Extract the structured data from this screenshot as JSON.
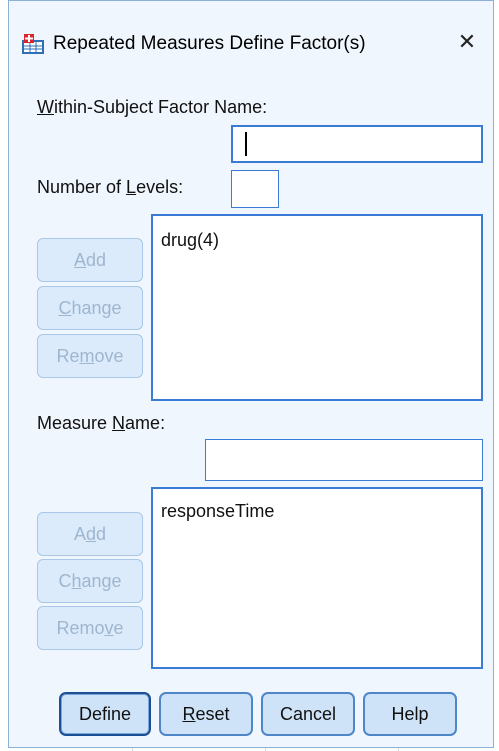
{
  "dialog": {
    "title": "Repeated Measures Define Factor(s)",
    "close_glyph": "✕"
  },
  "within_factor": {
    "label_prefix": "W",
    "label_rest": "ithin-Subject Factor Name:",
    "value": ""
  },
  "levels": {
    "label_pre": "Number of ",
    "label_u": "L",
    "label_post": "evels:",
    "value": ""
  },
  "factor_buttons": {
    "add": {
      "pre": "",
      "u": "A",
      "post": "dd"
    },
    "change": {
      "pre": "",
      "u": "C",
      "post": "hange"
    },
    "remove": {
      "pre": "Re",
      "u": "m",
      "post": "ove"
    }
  },
  "factor_list": [
    "drug(4)"
  ],
  "measure": {
    "label_pre": "Measure ",
    "label_u": "N",
    "label_post": "ame:",
    "value": ""
  },
  "measure_buttons": {
    "add": {
      "pre": "A",
      "u": "d",
      "post": "d"
    },
    "change": {
      "pre": "C",
      "u": "h",
      "post": "ange"
    },
    "remove": {
      "pre": "Remo",
      "u": "v",
      "post": "e"
    }
  },
  "measure_list": [
    "responseTime"
  ],
  "actions": {
    "define": "Define",
    "reset": {
      "pre": "",
      "u": "R",
      "post": "eset"
    },
    "cancel": "Cancel",
    "help": "Help"
  },
  "colors": {
    "dialog_bg": "#f0f6fd",
    "field_border": "#3a7bd5",
    "disabled_text": "#9fb6cf"
  }
}
